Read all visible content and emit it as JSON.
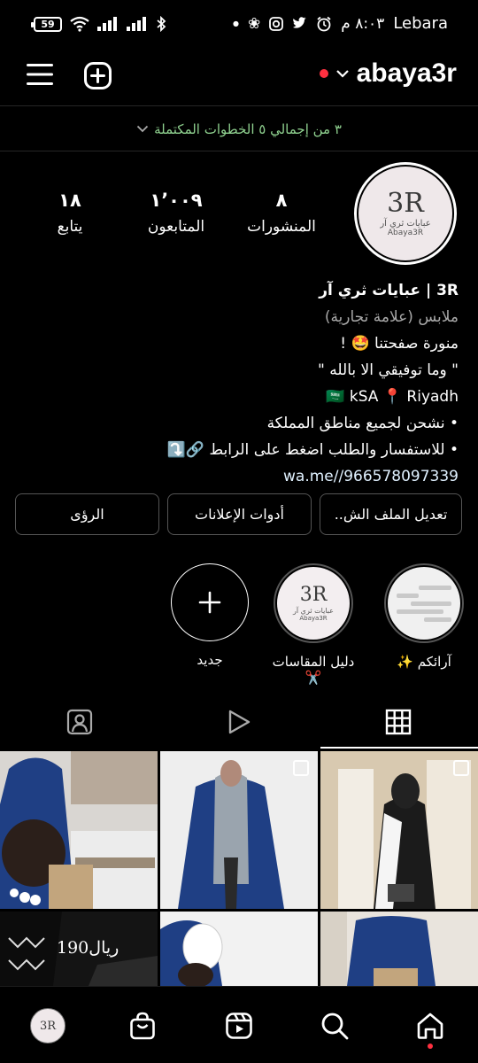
{
  "status_bar": {
    "battery": "59",
    "time": "٨:٠٣ م",
    "carrier": "Lebara"
  },
  "header": {
    "username": "abaya3r",
    "steps_text": "٣ من إجمالي ٥ الخطوات المكتملة"
  },
  "profile": {
    "avatar_logo": "3R",
    "avatar_subtitle": "عبايات ثري آر",
    "avatar_caption": "Abaya3R",
    "stats": [
      {
        "value": "٨",
        "label": "المنشورات"
      },
      {
        "value": "١٬٠٠٩",
        "label": "المتابعون"
      },
      {
        "value": "١٨",
        "label": "يتابع"
      }
    ],
    "bio": {
      "name": "3R | عبايات ثري آر",
      "category": "ملابس (علامة تجارية)",
      "lines": [
        "منورة صفحتنا 🤩 !",
        "\" وما توفيقي الا بالله \"",
        "🇸🇦 kSA 📍 Riyadh",
        "• نشحن لجميع مناطق المملكة",
        "• للاستفسار والطلب اضغط على الرابط 🔗⤵️"
      ],
      "link": "wa.me//966578097339"
    }
  },
  "buttons": {
    "edit_profile": "تعديل الملف الش..",
    "ad_tools": "أدوات الإعلانات",
    "insights": "الرؤى"
  },
  "highlights": [
    {
      "label": "آرائكم ✨"
    },
    {
      "label": "دليل المقاسات ✂️"
    },
    {
      "label": "جديد"
    }
  ],
  "grid": {
    "price_text": "190ريال"
  },
  "colors": {
    "background": "#000000",
    "accent_red": "#ff3040",
    "steps_green": "#8fd18f",
    "abaya_blue": "#1f3f84"
  }
}
